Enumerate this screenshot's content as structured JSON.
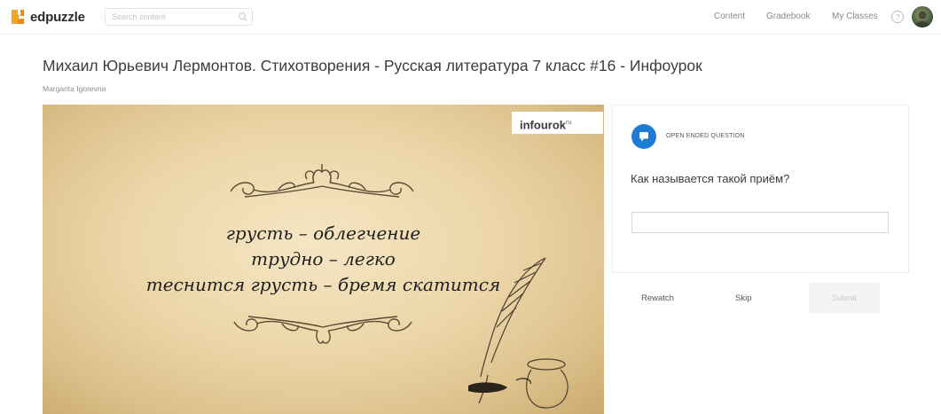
{
  "app": {
    "brand": "edpuzzle",
    "search": {
      "placeholder": "Search content"
    },
    "nav": {
      "content": "Content",
      "gradebook": "Gradebook",
      "my_classes": "My Classes"
    }
  },
  "lesson": {
    "title": "Михаил Юрьевич Лермонтов. Стихотворения - Русская литература 7 класс #16 - Инфоурок",
    "author": "Margarita Igorevna"
  },
  "video": {
    "brand": "infourok",
    "brand_suffix": "ru",
    "lines": [
      "грусть – облегчение",
      "трудно – легко",
      "теснится грусть – бремя скатится"
    ]
  },
  "question": {
    "type_label": "OPEN ENDED QUESTION",
    "text": "Как называется такой приём?",
    "answer_value": ""
  },
  "actions": {
    "rewatch": "Rewatch",
    "skip": "Skip",
    "submit": "Submit"
  },
  "colors": {
    "accent": "#1f7bd6",
    "logo_orange": "#f5a623"
  }
}
